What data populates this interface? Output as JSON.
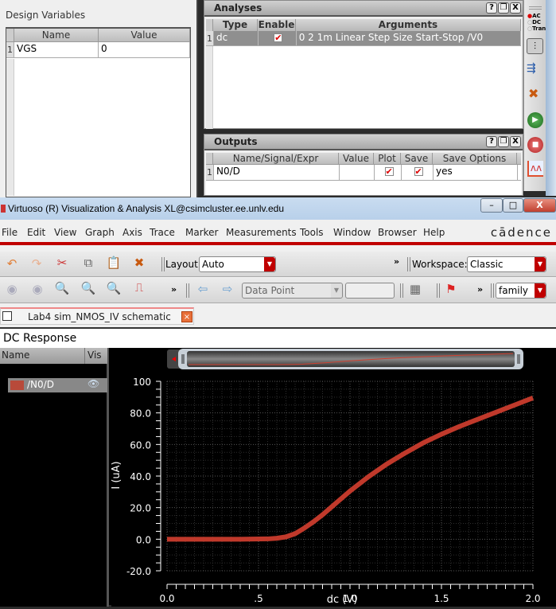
{
  "design_variables": {
    "title": "Design Variables",
    "columns": [
      "Name",
      "Value"
    ],
    "rows": [
      {
        "num": "1",
        "name": "VGS",
        "value": "0"
      }
    ]
  },
  "analyses": {
    "title": "Analyses",
    "columns": [
      "Type",
      "Enable",
      "Arguments"
    ],
    "rows": [
      {
        "num": "1",
        "type": "dc",
        "enabled": true,
        "arguments": "0 2 1m Linear Step Size Start-Stop /V0"
      }
    ],
    "buttons": {
      "help": "?",
      "float": "❐",
      "close": "X"
    }
  },
  "outputs": {
    "title": "Outputs",
    "columns": [
      "Name/Signal/Expr",
      "Value",
      "Plot",
      "Save",
      "Save Options"
    ],
    "rows": [
      {
        "num": "1",
        "name": "N0/D",
        "value": "",
        "plot": true,
        "save": true,
        "save_options": "yes"
      }
    ]
  },
  "side_toolbar": {
    "radio": [
      "AC",
      "DC",
      "Trans"
    ],
    "selected_radio": "AC",
    "icons": [
      "settings-sliders-icon",
      "outputs-setup-icon",
      "delete-icon",
      "run-icon",
      "stop-icon",
      "plot-outputs-icon"
    ]
  },
  "window": {
    "title": "Virtuoso (R) Visualization & Analysis XL@csimcluster.ee.unlv.edu",
    "controls": {
      "minimize": "–",
      "maximize": "□",
      "close": "X"
    }
  },
  "menubar": {
    "items": [
      "File",
      "Edit",
      "View",
      "Graph",
      "Axis",
      "Trace",
      "Marker",
      "Measurements",
      "Tools",
      "Window",
      "Browser",
      "Help"
    ],
    "brand": "cādence"
  },
  "toolbar1": {
    "layout_label": "Layout:",
    "layout_value": "Auto",
    "workspace_label": "Workspace:",
    "workspace_value": "Classic",
    "more": "»"
  },
  "toolbar2": {
    "data_point_value": "Data Point",
    "data_point_input": "",
    "family_value": "family",
    "more": "»"
  },
  "tab": {
    "label": "Lab4 sim_NMOS_IV schematic",
    "close": "×"
  },
  "graph": {
    "window_title": "DC Response",
    "legend_columns": [
      "Name",
      "Vis"
    ],
    "legend_items": [
      {
        "name": "/N0/D",
        "color": "#c0392b"
      }
    ]
  },
  "chart_data": {
    "type": "line",
    "title": "DC Response",
    "xlabel": "dc (V)",
    "ylabel": "I (uA)",
    "xlim": [
      0,
      2.0
    ],
    "ylim": [
      -20,
      100
    ],
    "xticks": [
      "0.0",
      ".5",
      "1.0",
      "1.5",
      "2.0"
    ],
    "yticks": [
      "100",
      "80.0",
      "60.0",
      "40.0",
      "20.0",
      "0.0",
      "-20.0"
    ],
    "grid": true,
    "series": [
      {
        "name": "/N0/D",
        "color": "#c0392b",
        "x": [
          0.0,
          0.2,
          0.4,
          0.55,
          0.6,
          0.65,
          0.7,
          0.75,
          0.8,
          0.85,
          0.9,
          0.95,
          1.0,
          1.1,
          1.2,
          1.3,
          1.4,
          1.5,
          1.6,
          1.7,
          1.8,
          1.9,
          2.0
        ],
        "y": [
          0.0,
          0.0,
          0.0,
          0.2,
          0.6,
          1.5,
          3.5,
          7.0,
          11.0,
          15.5,
          20.5,
          25.5,
          30.5,
          39.5,
          47.5,
          54.5,
          61.0,
          66.5,
          71.5,
          76.0,
          80.5,
          85.0,
          89.5
        ]
      }
    ]
  }
}
